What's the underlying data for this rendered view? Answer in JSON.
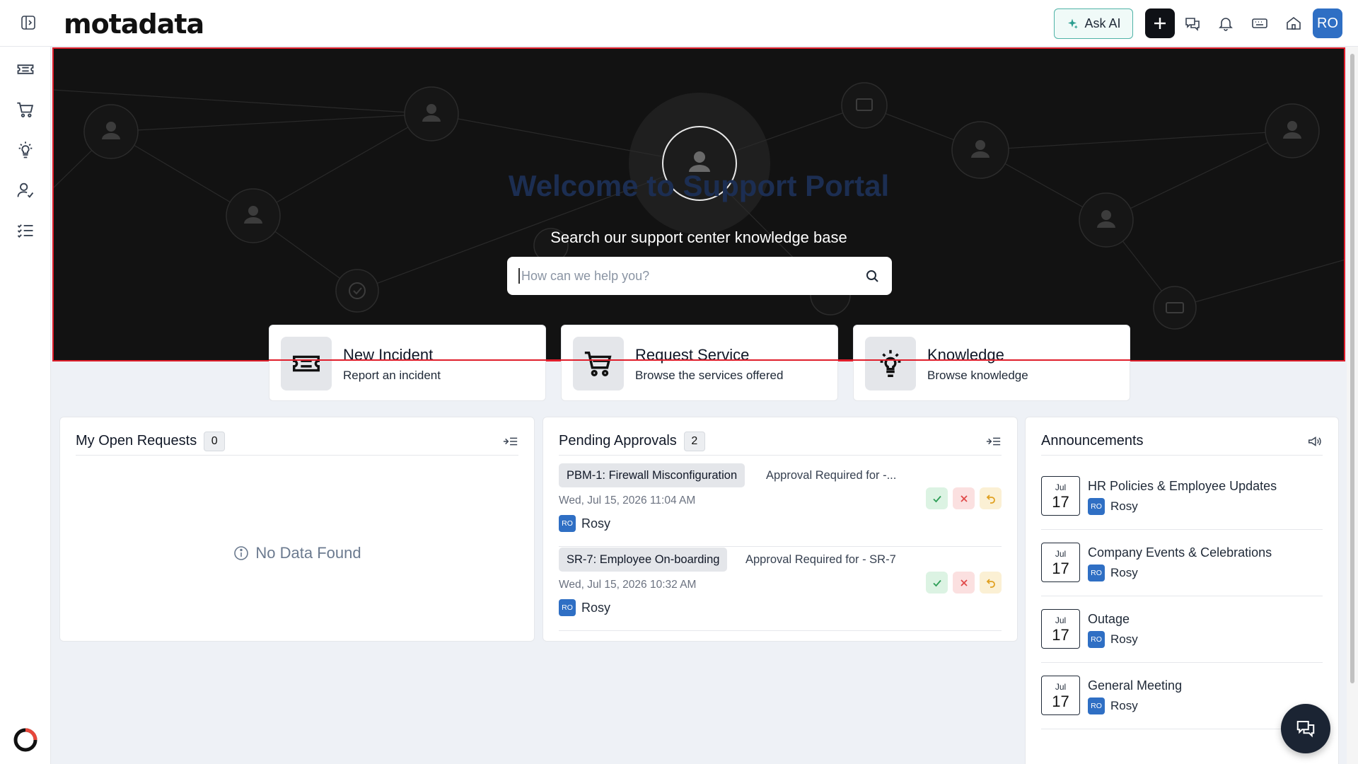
{
  "header": {
    "logo_text": "motadata",
    "ask_ai_label": "Ask AI",
    "user_initials": "RO"
  },
  "sidebar": {
    "items": [
      {
        "icon": "ticket-icon",
        "name": "Incidents"
      },
      {
        "icon": "cart-icon",
        "name": "Service Catalog"
      },
      {
        "icon": "lightbulb-icon",
        "name": "Knowledge"
      },
      {
        "icon": "user-check-icon",
        "name": "Approvals"
      },
      {
        "icon": "checklist-icon",
        "name": "Tasks"
      }
    ]
  },
  "hero": {
    "title": "Welcome to Support Portal",
    "subtitle": "Search our support center knowledge base",
    "search_placeholder": "How can we help you?"
  },
  "quick_actions": [
    {
      "icon": "ticket-icon",
      "title": "New Incident",
      "description": "Report an incident"
    },
    {
      "icon": "cart-icon",
      "title": "Request Service",
      "description": "Browse the services offered"
    },
    {
      "icon": "lightbulb-icon",
      "title": "Knowledge",
      "description": "Browse knowledge"
    }
  ],
  "open_requests": {
    "title": "My Open Requests",
    "count": "0",
    "empty_text": "No Data Found"
  },
  "pending_approvals": {
    "title": "Pending Approvals",
    "count": "2",
    "items": [
      {
        "tag": "PBM-1: Firewall Misconfiguration",
        "description": "Approval Required for -...",
        "date": "Wed, Jul 15, 2026 11:04 AM",
        "user_initials": "RO",
        "user": "Rosy"
      },
      {
        "tag": "SR-7: Employee On-boarding",
        "description": "Approval Required for - SR-7",
        "date": "Wed, Jul 15, 2026 10:32 AM",
        "user_initials": "RO",
        "user": "Rosy"
      }
    ]
  },
  "announcements": {
    "title": "Announcements",
    "items": [
      {
        "month": "Jul",
        "day": "17",
        "title": "HR Policies & Employee Updates",
        "user_initials": "RO",
        "user": "Rosy"
      },
      {
        "month": "Jul",
        "day": "17",
        "title": "Company Events & Celebrations",
        "user_initials": "RO",
        "user": "Rosy"
      },
      {
        "month": "Jul",
        "day": "17",
        "title": "Outage",
        "user_initials": "RO",
        "user": "Rosy"
      },
      {
        "month": "Jul",
        "day": "17",
        "title": "General Meeting",
        "user_initials": "RO",
        "user": "Rosy"
      }
    ]
  },
  "colors": {
    "accent": "#2f6fc4",
    "hero_bg": "#121212",
    "highlight_outline": "#e01e2b",
    "ask_ai_border": "#4fb3a7"
  }
}
